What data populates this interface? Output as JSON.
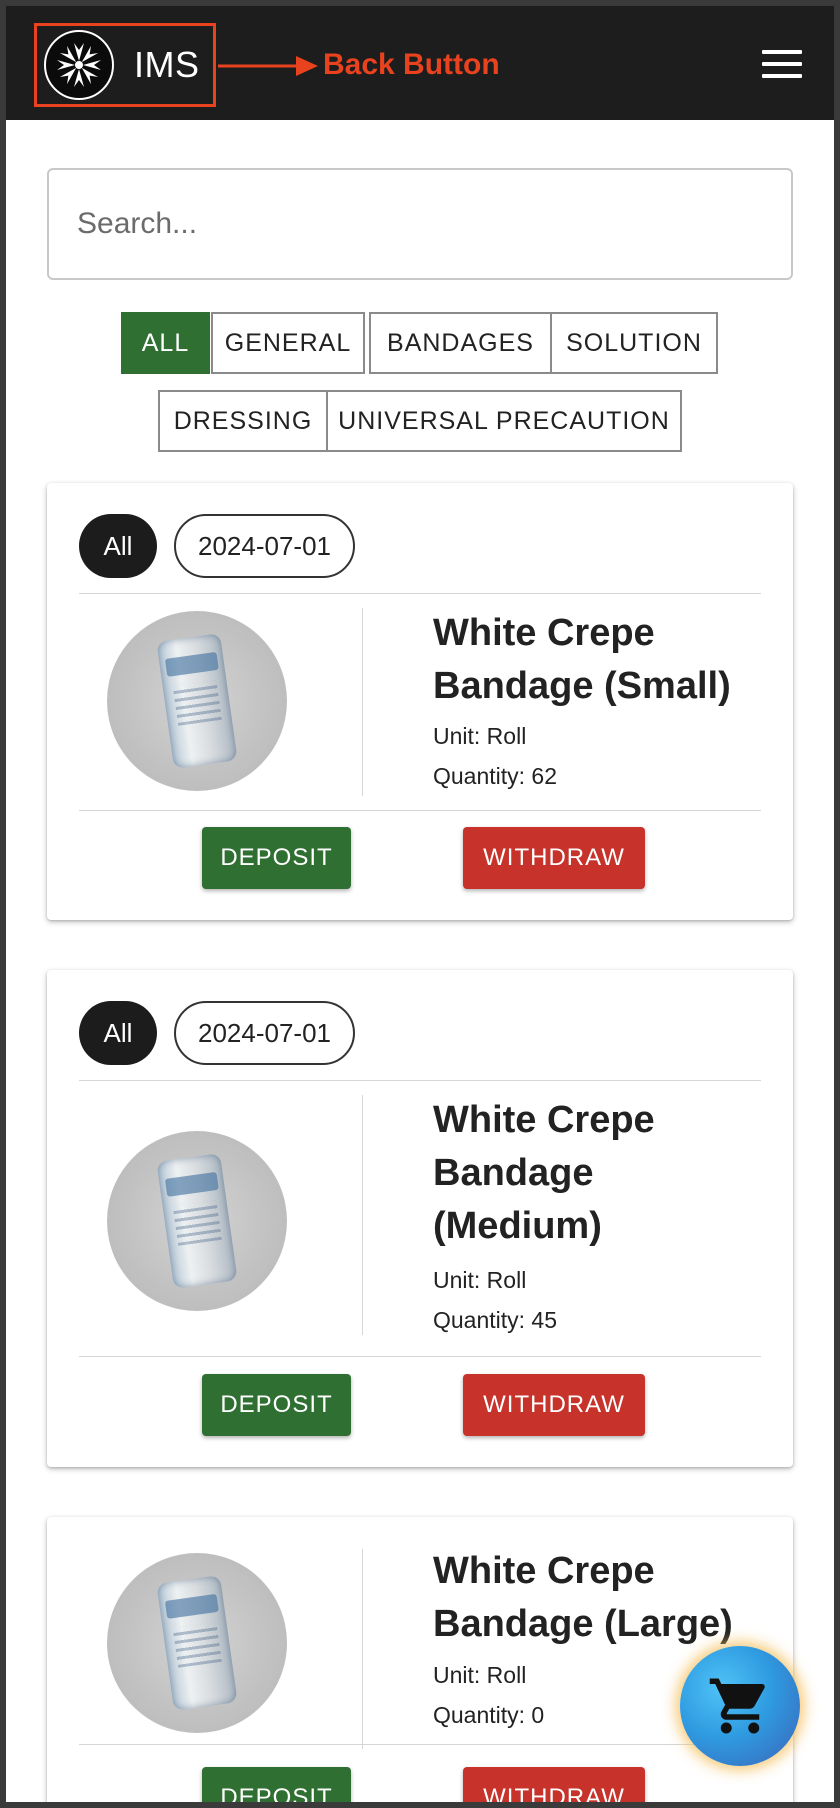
{
  "header": {
    "brand": "IMS",
    "annotation_label": "Back Button"
  },
  "search": {
    "placeholder": "Search..."
  },
  "filters": [
    "ALL",
    "GENERAL",
    "BANDAGES",
    "SOLUTION",
    "DRESSING",
    "UNIVERSAL PRECAUTION"
  ],
  "active_filter": "ALL",
  "items": [
    {
      "tag": "All",
      "date": "2024-07-01",
      "name_lines": [
        "White Crepe",
        "Bandage (Small)"
      ],
      "unit": "Unit: Roll",
      "quantity": "Quantity: 62",
      "deposit_label": "DEPOSIT",
      "withdraw_label": "WITHDRAW"
    },
    {
      "tag": "All",
      "date": "2024-07-01",
      "name_lines": [
        "White Crepe",
        "Bandage",
        "(Medium)"
      ],
      "unit": "Unit: Roll",
      "quantity": "Quantity: 45",
      "deposit_label": "DEPOSIT",
      "withdraw_label": "WITHDRAW"
    },
    {
      "name_lines": [
        "White Crepe",
        "Bandage (Large)"
      ],
      "unit": "Unit: Roll",
      "quantity": "Quantity: 0",
      "deposit_label": "DEPOSIT",
      "withdraw_label": "WITHDRAW"
    }
  ],
  "icons": {
    "logo": "star-cross-logo-icon",
    "menu": "hamburger-menu-icon",
    "cart": "shopping-cart-icon"
  },
  "colors": {
    "header_bg": "#1d1d1d",
    "primary_green": "#2f6f31",
    "withdraw_red": "#c7332b",
    "annotation_orange": "#e8421e",
    "fab_blue": "#2f9be0"
  }
}
